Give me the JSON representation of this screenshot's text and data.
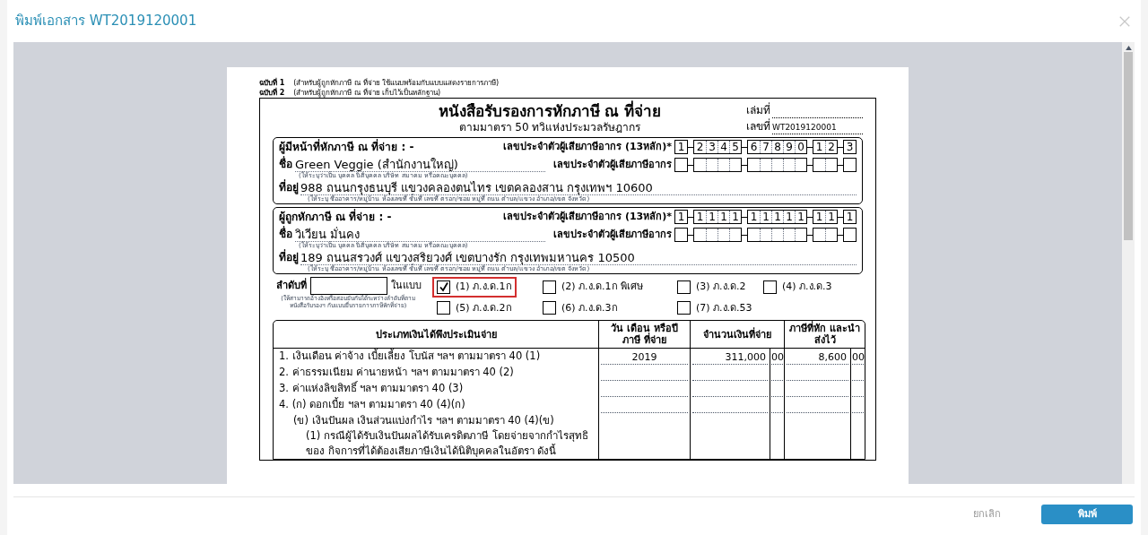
{
  "dialog": {
    "title": "พิมพ์เอกสาร WT2019120001"
  },
  "document": {
    "copies": [
      {
        "label": "ฉบับที่ 1",
        "text": "(สำหรับผู้ถูกหักภาษี ณ ที่จ่าย ใช้แนบพร้อมกับแบบแสดงรายการภาษี)"
      },
      {
        "label": "ฉบับที่ 2",
        "text": "(สำหรับผู้ถูกหักภาษี ณ ที่จ่าย เก็บไว้เป็นหลักฐาน)"
      }
    ],
    "title": "หนังสือรับรองการหักภาษี ณ ที่จ่าย",
    "subtitle": "ตามมาตรา 50 ทวิแห่งประมวลรัษฎากร",
    "book_no_label": "เล่มที่",
    "doc_no_label": "เลขที่",
    "doc_no": "WT2019120001",
    "parties": [
      {
        "heading": "ผู้มีหน้าที่หักภาษี ณ ที่จ่าย : -",
        "id_label": "เลขประจำตัวผู้เสียภาษีอากร (13หลัก)*",
        "id_groups": [
          [
            "1"
          ],
          [
            "2",
            "3",
            "4",
            "5"
          ],
          [
            "6",
            "7",
            "8",
            "9",
            "0"
          ],
          [
            "1",
            "2"
          ],
          [
            "3"
          ]
        ],
        "name_label": "ชื่อ",
        "name": "Green Veggie (สำนักงานใหญ่)",
        "tax_id_label": "เลขประจำตัวผู้เสียภาษีอากร",
        "name_hint": "(ให้ระบุว่าเป็น บุคคล นิติบุคคล บริษัท สมาคม หรือคณะบุคคล)",
        "address_label": "ที่อยู่",
        "address": "988 ถนนกรุงธนบุรี แขวงคลองตนไทร เขตคลองสาน กรุงเทพฯ 10600",
        "address_hint": "(ให้ระบุ ชื่ออาคาร/หมู่บ้าน ห้องเลขที่ ชั้นที่ เลขที่ ตรอก/ซอย หมู่ที่ ถนน ตำบล/แขวง อำเภอ/เขต จังหวัด)"
      },
      {
        "heading": "ผู้ถูกหักภาษี ณ ที่จ่าย : -",
        "id_label": "เลขประจำตัวผู้เสียภาษีอากร (13หลัก)*",
        "id_groups": [
          [
            "1"
          ],
          [
            "1",
            "1",
            "1",
            "1"
          ],
          [
            "1",
            "1",
            "1",
            "1",
            "1"
          ],
          [
            "1",
            "1"
          ],
          [
            "1"
          ]
        ],
        "name_label": "ชื่อ",
        "name": "วิเวียน มั่นคง",
        "tax_id_label": "เลขประจำตัวผู้เสียภาษีอากร",
        "name_hint": "(ให้ระบุว่าเป็น บุคคล นิติบุคคล บริษัท สมาคม หรือคณะบุคคล)",
        "address_label": "ที่อยู่",
        "address": "189 ถนนสรวงศ์ แขวงสริยวงศ์ เขตบางรัก กรุงเทพมหานคร 10500",
        "address_hint": "(ให้ระบุ ชื่ออาคาร/หมู่บ้าน ห้องเลขที่ ชั้นที่ เลขที่ ตรอก/ซอย หมู่ที่ ถนน ตำบล/แขวง อำเภอ/เขต จังหวัด)"
      }
    ],
    "sequence_label": "ลำดับที่",
    "sequence_hint": "(ให้สามารถอ้างอิงหรือสอบยันกันได้ระหว่างลำดับที่ตาม หนังสือรับรองฯ กับแบบยื่นรายการภาษีหักที่จ่าย)",
    "form_label": "ในแบบ",
    "forms": [
      {
        "label": "(1) ภ.ง.ด.1ก",
        "checked": true
      },
      {
        "label": "(2) ภ.ง.ด.1ก พิเศษ",
        "checked": false
      },
      {
        "label": "(3) ภ.ง.ด.2",
        "checked": false
      },
      {
        "label": "(4) ภ.ง.ด.3",
        "checked": false
      },
      {
        "label": "(5) ภ.ง.ด.2ก",
        "checked": false
      },
      {
        "label": "(6) ภ.ง.ด.3ก",
        "checked": false
      },
      {
        "label": "(7) ภ.ง.ด.53",
        "checked": false
      }
    ],
    "table": {
      "columns": [
        "ประเภทเงินได้พึงประเมินจ่าย",
        "วัน เดือน หรือปีภาษี ที่จ่าย",
        "จำนวนเงินที่จ่าย",
        "ภาษีที่หัก และนำส่งไว้"
      ],
      "rows": [
        {
          "text": "1. เงินเดือน ค่าจ้าง เบี้ยเลี้ยง โบนัส ฯลฯ ตามมาตรา 40 (1)",
          "date": "2019",
          "amount": "311,000",
          "amount_dec": "00",
          "tax": "8,600",
          "tax_dec": "00"
        },
        {
          "text": "2. ค่าธรรมเนียม ค่านายหน้า ฯลฯ ตามมาตรา 40 (2)"
        },
        {
          "text": "3. ค่าแห่งลิขสิทธิ์ ฯลฯ ตามมาตรา 40 (3)"
        },
        {
          "text": "4. (ก) ดอกเบี้ย ฯลฯ ตามมาตรา 40 (4)(ก)",
          "children": [
            {
              "text": "(ข) เงินปันผล เงินส่วนแบ่งกำไร ฯลฯ ตามมาตรา 40 (4)(ข)",
              "children": [
                {
                  "text": "(1) กรณีผู้ได้รับเงินปันผลได้รับเครดิตภาษี โดยจ่ายจากกำไรสุทธิของ กิจการที่ได้ต้องเสียภาษีเงินได้นิติบุคคลในอัตรา ดังนี้"
                }
              ]
            }
          ]
        }
      ]
    }
  },
  "buttons": [
    {
      "label": "ยกเลิก",
      "kind": "secondary"
    },
    {
      "label": "พิมพ์",
      "kind": "primary"
    }
  ]
}
